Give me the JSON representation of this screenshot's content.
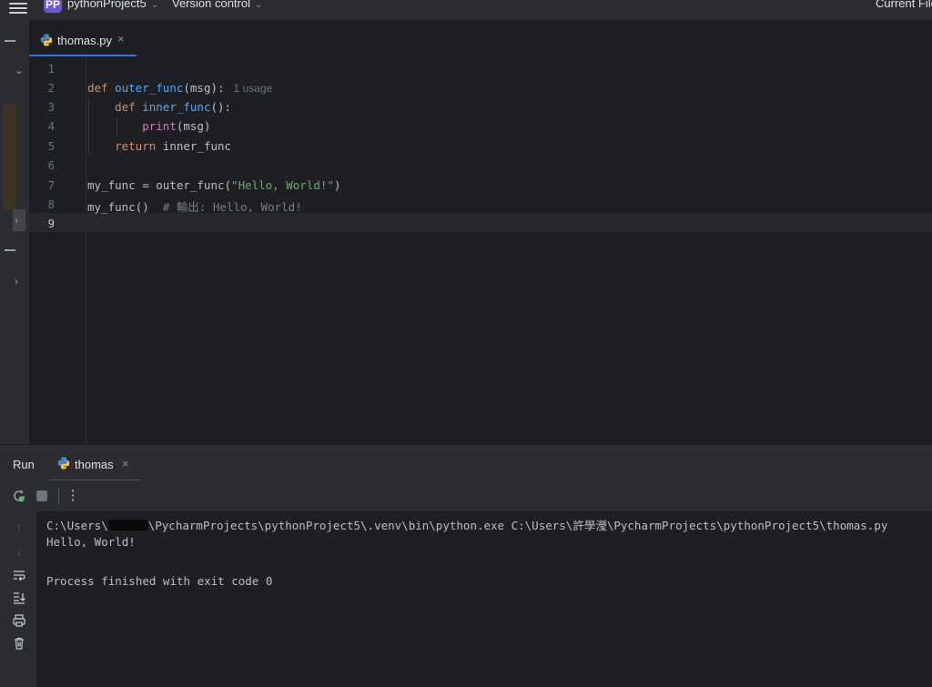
{
  "titlebar": {
    "project_badge": "PP",
    "project_name": "pythonProject5",
    "version_control": "Version control",
    "run_config": "Current File"
  },
  "editor": {
    "tab": {
      "label": "thomas.py",
      "close": "×"
    },
    "line_numbers": [
      "1",
      "2",
      "3",
      "4",
      "5",
      "6",
      "7",
      "8",
      "9"
    ],
    "lines": {
      "l2": {
        "kw": "def",
        "name": "outer_func",
        "rest": "(msg):",
        "hint": "1 usage"
      },
      "l3": {
        "kw": "def",
        "name": "inner_func",
        "rest": "():"
      },
      "l4": {
        "name": "print",
        "rest": "(msg)"
      },
      "l5": {
        "kw": "return",
        "rest": " inner_func"
      },
      "l7": {
        "start": "my_func = outer_func(",
        "str": "\"Hello, World!\"",
        "end": ")"
      },
      "l8": {
        "start": "my_func()  ",
        "comment": "# 輸出: Hello, World!"
      }
    }
  },
  "run_panel": {
    "title": "Run",
    "tab": {
      "label": "thomas",
      "close": "×"
    },
    "console": {
      "cmd_prefix": "C:\\Users\\",
      "cmd_suffix": "\\PycharmProjects\\pythonProject5\\.venv\\bin\\python.exe C:\\Users\\許學瀅\\PycharmProjects\\pythonProject5\\thomas.py",
      "output": "Hello, World!",
      "exit": "Process finished with exit code 0"
    }
  },
  "colors": {
    "accent": "#3574f0",
    "keyword": "#cf8e6d",
    "function": "#56a8f5",
    "string": "#6aab73",
    "comment": "#7a7e85"
  }
}
